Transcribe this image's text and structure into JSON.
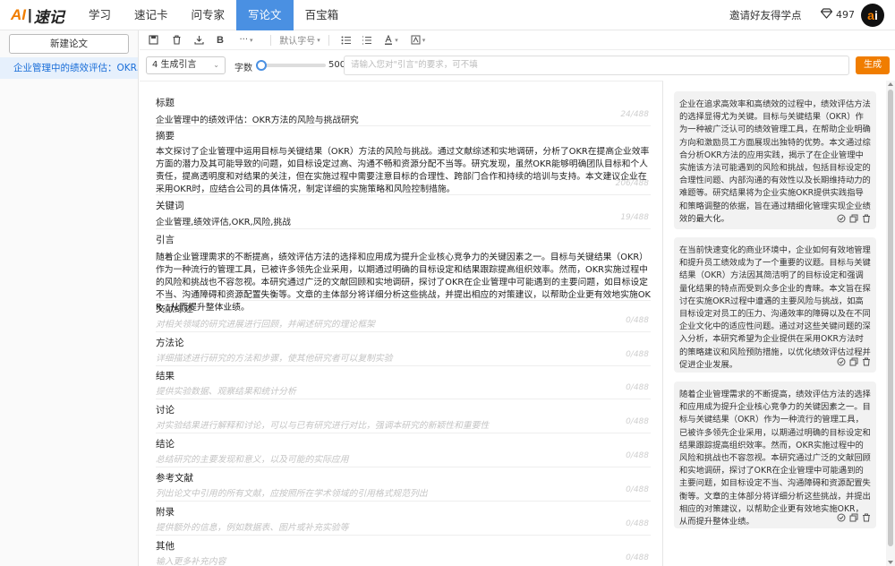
{
  "app": {
    "logo_ai": "AI",
    "logo_bar": "|",
    "logo_rest": "速记",
    "nav_tabs": [
      "学习",
      "速记卡",
      "问专家",
      "写论文",
      "百宝箱"
    ],
    "invite": "邀请好友得学点",
    "points": "497",
    "avatar_a": "a",
    "avatar_i": "i"
  },
  "sidebar": {
    "new_paper": "新建论文",
    "item": "企业管理中的绩效评估：OKR..."
  },
  "toolbar": {
    "more": "···",
    "font_size": "默认字号"
  },
  "generate": {
    "mode": "4 生成引言",
    "word_count_label": "字数",
    "word_count_value": "500",
    "word_count_level": 0,
    "placeholder": "请输入您对\"引言\"的要求，可不填",
    "button": "生成"
  },
  "sections": [
    {
      "title": "标题",
      "body": "企业管理中的绩效评估：OKR方法的风险与挑战研究",
      "count": "24/488",
      "placeholder": false
    },
    {
      "title": "摘要",
      "body": "本文探讨了企业管理中运用目标与关键结果（OKR）方法的风险与挑战。通过文献综述和实地调研，分析了OKR在提高企业效率方面的潜力及其可能导致的问题，如目标设定过高、沟通不畅和资源分配不当等。研究发现，虽然OKR能够明确团队目标和个人责任，提高透明度和对结果的关注，但在实施过程中需要注意目标的合理性、跨部门合作和持续的培训与支持。本文建议企业在采用OKR时，应结合公司的具体情况，制定详细的实施策略和风险控制措施。",
      "count": "206/488",
      "placeholder": false
    },
    {
      "title": "关键词",
      "body": "企业管理,绩效评估,OKR,风险,挑战",
      "count": "19/488",
      "placeholder": false
    },
    {
      "title": "引言",
      "body": "随着企业管理需求的不断提高，绩效评估方法的选择和应用成为提升企业核心竞争力的关键因素之一。目标与关键结果（OKR）作为一种流行的管理工具，已被许多领先企业采用，以期通过明确的目标设定和结果跟踪提高组织效率。然而，OKR实施过程中的风险和挑战也不容忽视。本研究通过广泛的文献回顾和实地调研，探讨了OKR在企业管理中可能遇到的主要问题，如目标设定不当、沟通障碍和资源配置失衡等。文章的主体部分将详细分析这些挑战，并提出相应的对策建议，以帮助企业更有效地实施OKR，从而提升整体业绩。",
      "count": "",
      "placeholder": false
    },
    {
      "title": "文献综述",
      "body": "对相关领域的研究进展进行回顾，并阐述研究的理论框架",
      "count": "0/488",
      "placeholder": true
    },
    {
      "title": "方法论",
      "body": "详细描述进行研究的方法和步骤，使其他研究者可以复制实验",
      "count": "0/488",
      "placeholder": true
    },
    {
      "title": "结果",
      "body": "提供实验数据、观察结果和统计分析",
      "count": "0/488",
      "placeholder": true
    },
    {
      "title": "讨论",
      "body": "对实验结果进行解释和讨论，可以与已有研究进行对比，强调本研究的新颖性和重要性",
      "count": "0/488",
      "placeholder": true
    },
    {
      "title": "结论",
      "body": "总结研究的主要发现和意义，以及可能的实际应用",
      "count": "0/488",
      "placeholder": true
    },
    {
      "title": "参考文献",
      "body": "列出论文中引用的所有文献，应按照所在学术领域的引用格式规范列出",
      "count": "0/488",
      "placeholder": true
    },
    {
      "title": "附录",
      "body": "提供额外的信息，例如数据表、图片或补充实验等",
      "count": "0/488",
      "placeholder": true
    },
    {
      "title": "其他",
      "body": "输入更多补充内容",
      "count": "0/488",
      "placeholder": true
    }
  ],
  "cards": [
    "企业在追求高效率和高绩效的过程中，绩效评估方法的选择显得尤为关键。目标与关键结果（OKR）作为一种被广泛认可的绩效管理工具，在帮助企业明确方向和激励员工方面展现出独特的优势。本文通过综合分析OKR方法的应用实践，揭示了在企业管理中实施该方法可能遇到的风险和挑战，包括目标设定的合理性问题、内部沟通的有效性以及长期维持动力的难题等。研究结果将为企业实施OKR提供实践指导和策略调整的依据，旨在通过精细化管理实现企业绩效的最大化。",
    "在当前快速变化的商业环境中，企业如何有效地管理和提升员工绩效成为了一个重要的议题。目标与关键结果（OKR）方法因其简洁明了的目标设定和强调量化结果的特点而受到众多企业的青睐。本文旨在探讨在实施OKR过程中遭遇的主要风险与挑战，如高目标设定对员工的压力、沟通效率的障碍以及在不同企业文化中的适应性问题。通过对这些关键问题的深入分析，本研究希望为企业提供在采用OKR方法时的策略建议和风险预防措施，以优化绩效评估过程并促进企业发展。",
    "随着企业管理需求的不断提高，绩效评估方法的选择和应用成为提升企业核心竞争力的关键因素之一。目标与关键结果（OKR）作为一种流行的管理工具，已被许多领先企业采用，以期通过明确的目标设定和结果跟踪提高组织效率。然而，OKR实施过程中的风险和挑战也不容忽视。本研究通过广泛的文献回顾和实地调研，探讨了OKR在企业管理中可能遇到的主要问题，如目标设定不当、沟通障碍和资源配置失衡等。文章的主体部分将详细分析这些挑战，并提出相应的对策建议，以帮助企业更有效地实施OKR，从而提升整体业绩。"
  ]
}
